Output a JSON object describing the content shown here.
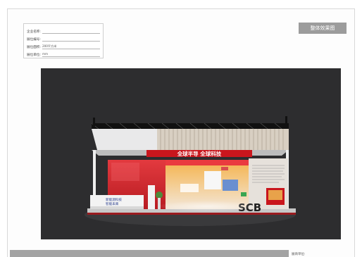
{
  "info": {
    "company_label": "企业名称:",
    "booth_no_label": "展位编号:",
    "area_label": "展位面积:",
    "area_value": "200平方米",
    "unit_label": "展位单位:",
    "unit_value": "mm"
  },
  "header": {
    "title": "整体效果图"
  },
  "render": {
    "banner_text": "全球半导 全球科技",
    "panel_text_line1": "新能源科技",
    "panel_text_line2": "智能未来",
    "brand_logo": "SCB"
  },
  "footer": {
    "label": "展商单位:"
  },
  "colors": {
    "booth_red": "#d8252a",
    "backdrop": "#2d2d2f",
    "title_button": "#9c9c9c"
  }
}
